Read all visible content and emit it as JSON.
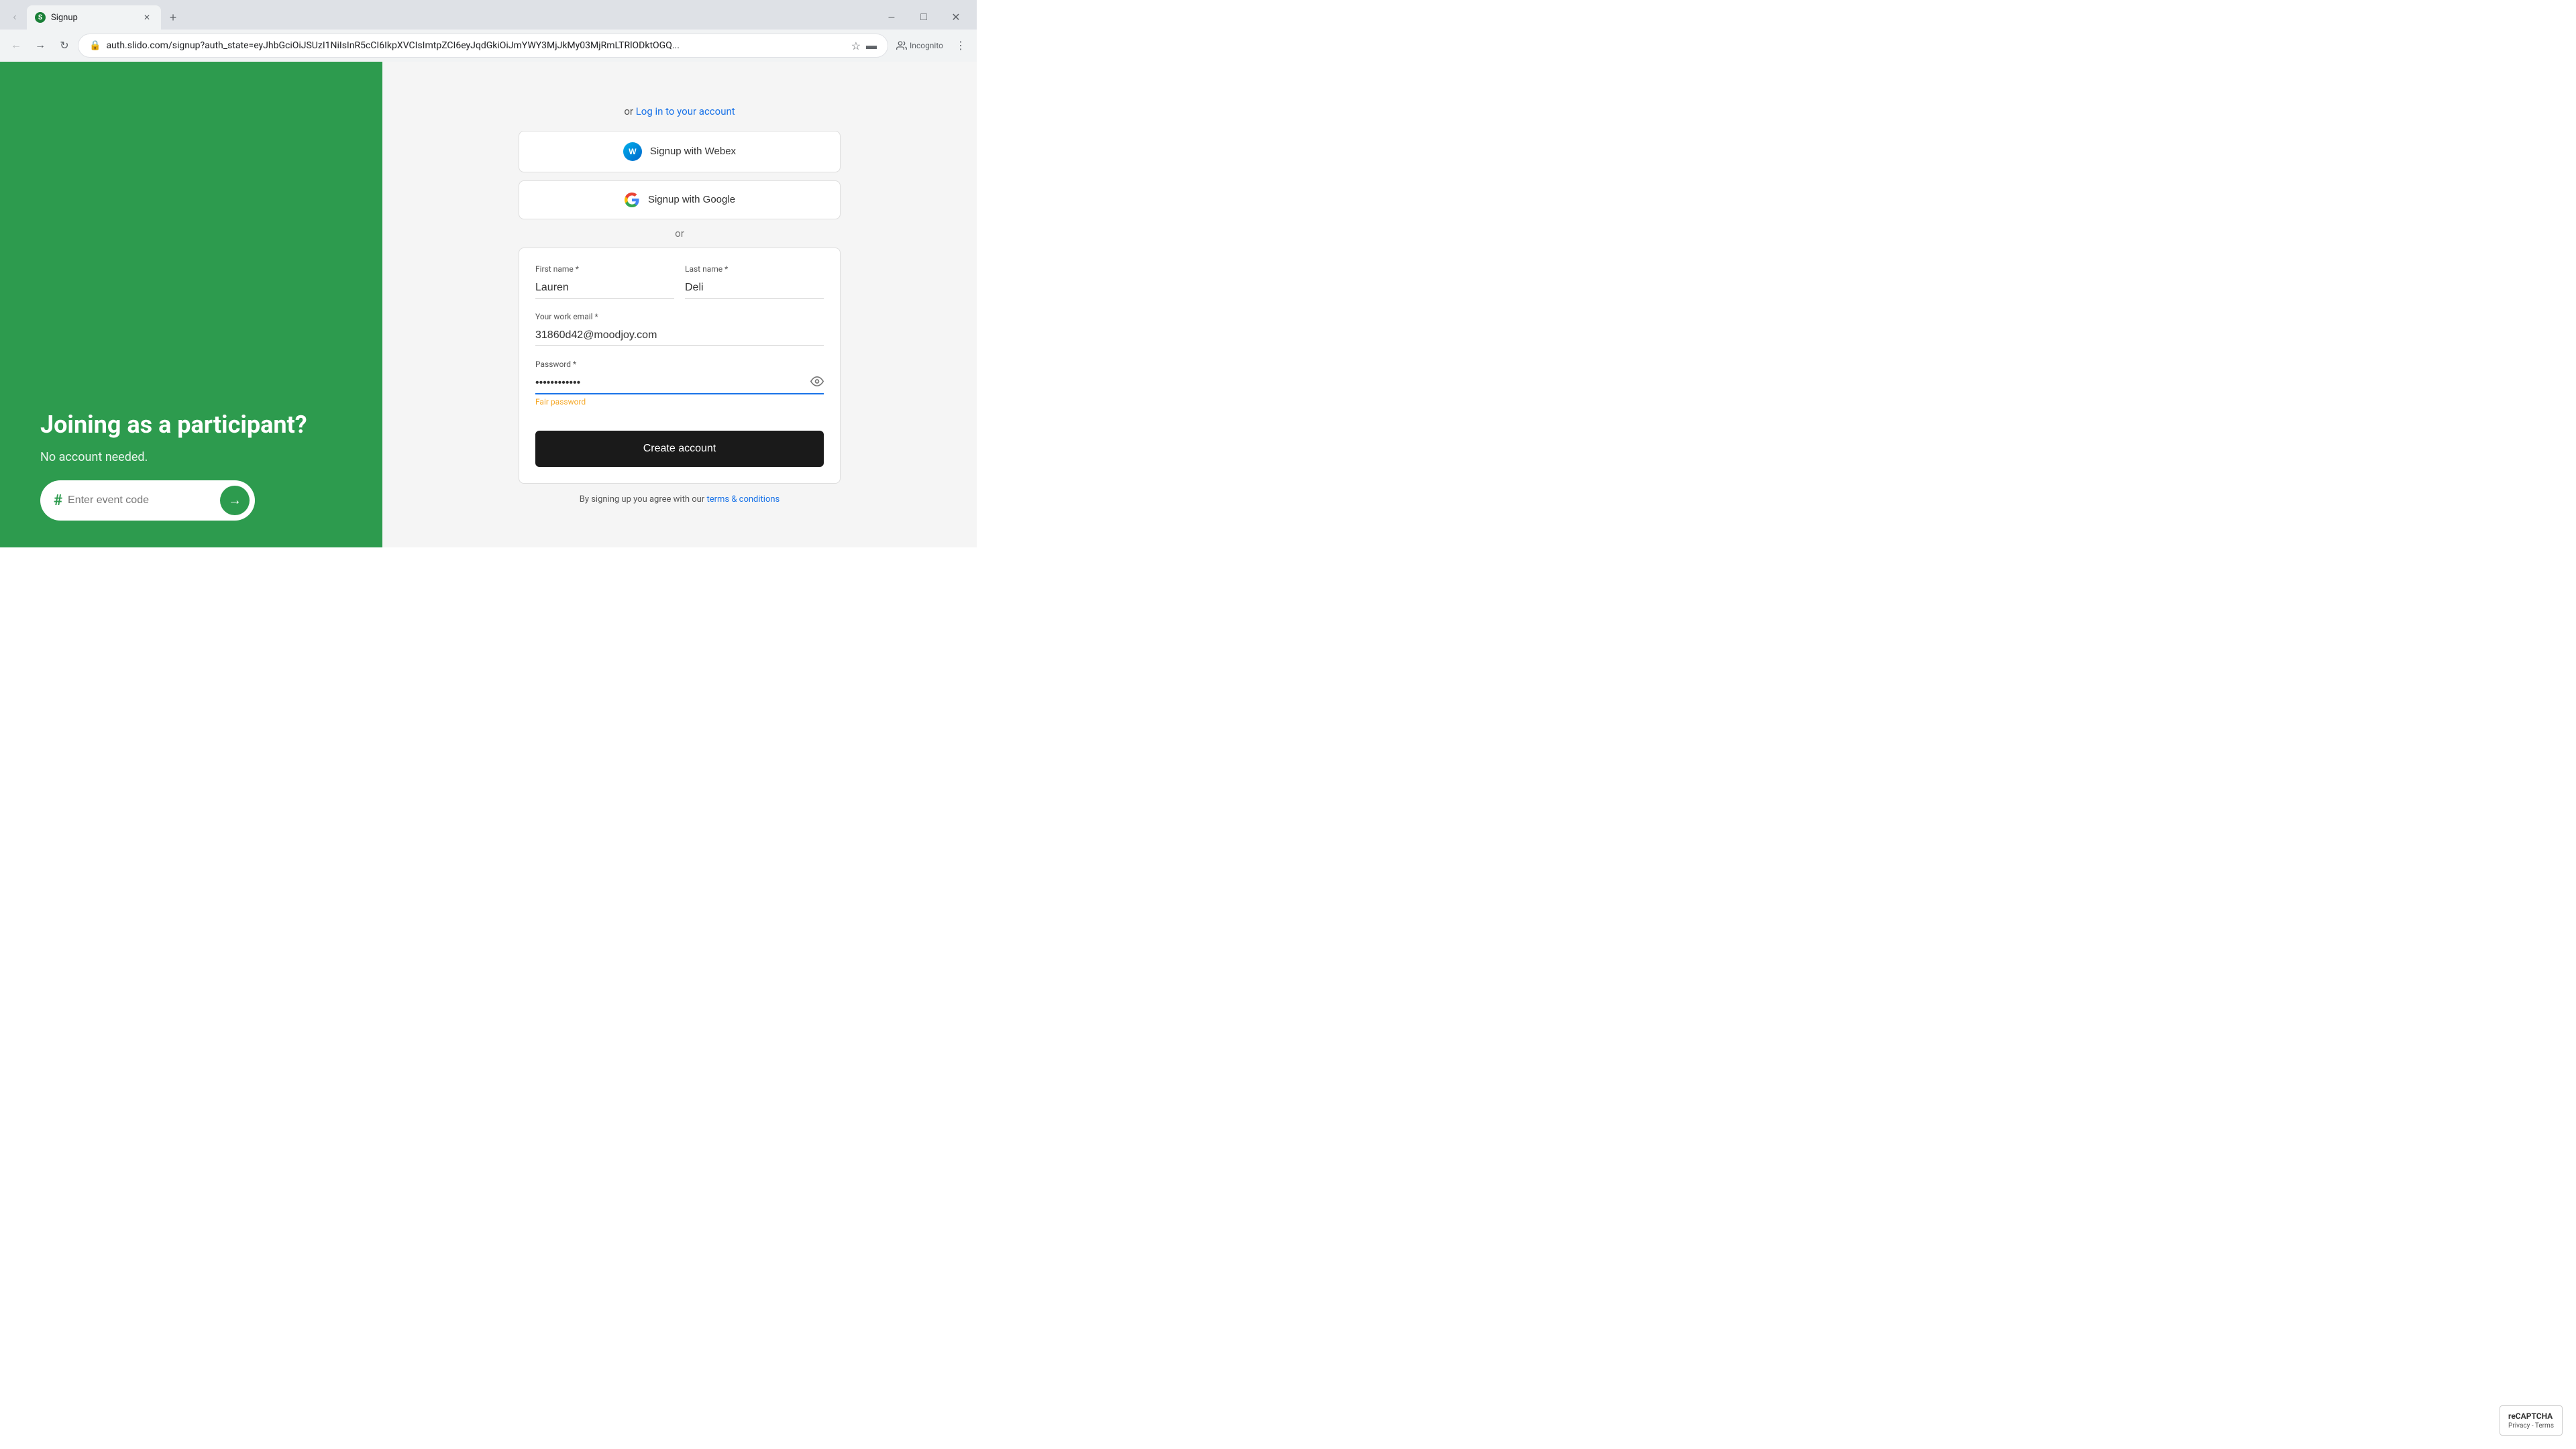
{
  "browser": {
    "tab_favicon": "S",
    "tab_title": "Signup",
    "url": "auth.slido.com/signup?auth_state=eyJhbGciOiJSUzI1NiIsInR5cCI6IkpXVCIsImtpZCI6eyJqdGkiOiJmYWY3MjJkMy03MjRmLTRlODktOGQ...",
    "incognito_label": "Incognito"
  },
  "left_panel": {
    "heading": "Joining as a participant?",
    "subtext": "No account needed.",
    "event_code_placeholder": "Enter event code",
    "hash_symbol": "#"
  },
  "right_panel": {
    "or_text": "or",
    "login_link_prefix": "or",
    "login_link_text": "Log in to your account",
    "webex_btn_label": "Signup with Webex",
    "google_btn_label": "Signup with Google",
    "divider_or": "or",
    "form": {
      "first_name_label": "First name *",
      "first_name_value": "Lauren",
      "last_name_label": "Last name *",
      "last_name_value": "Deli",
      "email_label": "Your work email *",
      "email_value": "31860d42@moodjoy.com",
      "password_label": "Password *",
      "password_value": "••••••••••••",
      "password_strength": "Fair password",
      "create_account_btn": "Create account"
    },
    "terms_prefix": "By signing up you agree with our",
    "terms_link": "terms & conditions"
  },
  "recaptcha": {
    "title": "reCAPTCHA",
    "subtitle": "Privacy - Terms"
  }
}
